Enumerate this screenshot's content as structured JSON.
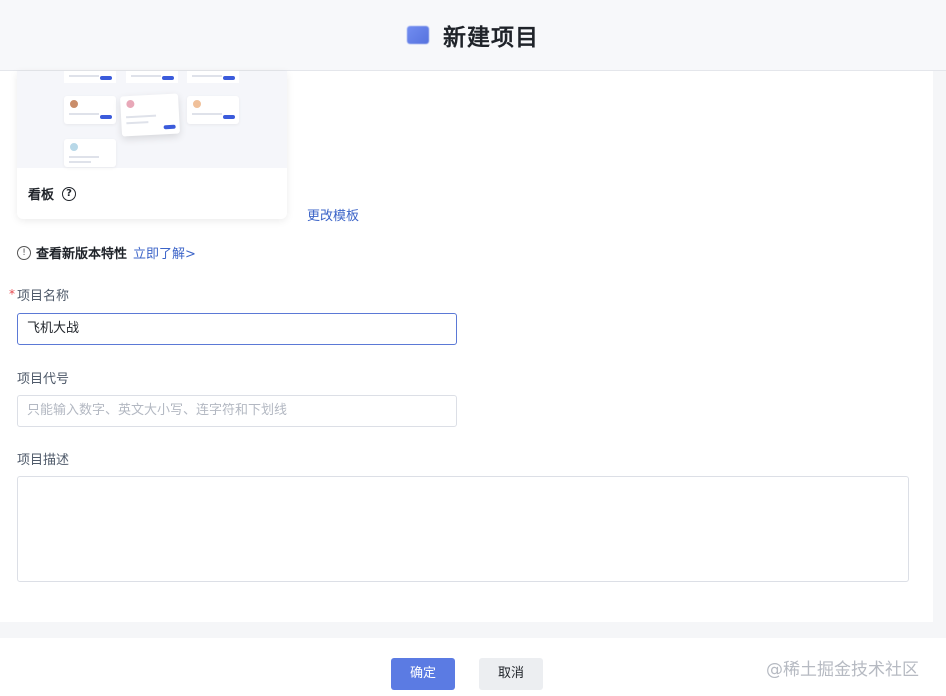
{
  "header": {
    "title": "新建项目"
  },
  "template": {
    "name": "看板",
    "change_link": "更改模板"
  },
  "feature": {
    "text": "查看新版本特性",
    "link": "立即了解>"
  },
  "form": {
    "name": {
      "label": "项目名称",
      "required_mark": "*",
      "value": "飞机大战"
    },
    "code": {
      "label": "项目代号",
      "placeholder": "只能输入数字、英文大小写、连字符和下划线"
    },
    "desc": {
      "label": "项目描述",
      "value": ""
    }
  },
  "footer": {
    "confirm": "确定",
    "cancel": "取消",
    "watermark": "@稀土掘金技术社区"
  },
  "colors": {
    "primary": "#5b7be3",
    "link": "#3c64c8",
    "required": "#e5484d"
  }
}
